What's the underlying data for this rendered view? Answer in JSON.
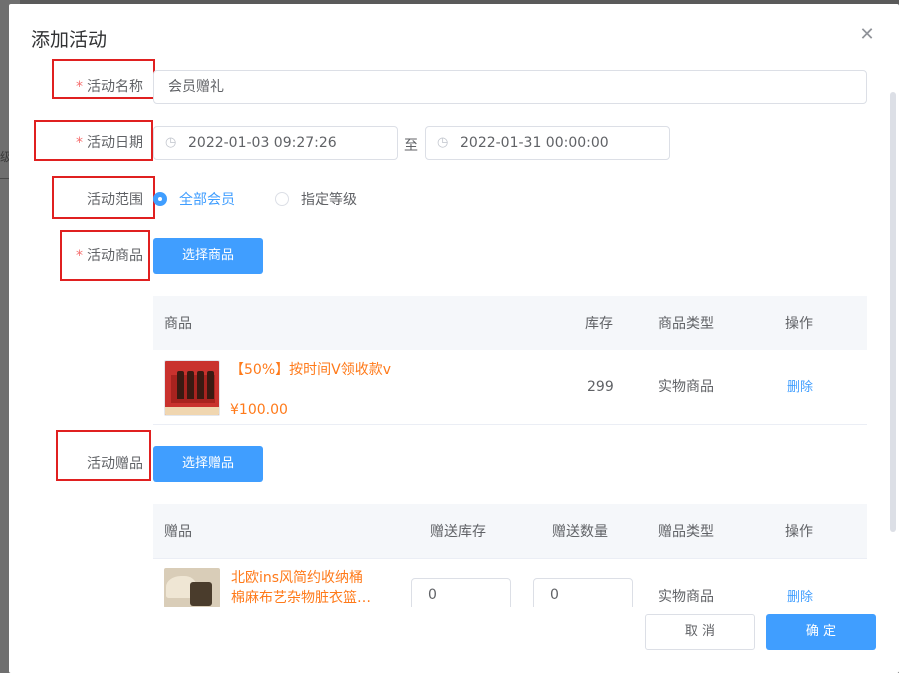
{
  "backdrop": {
    "fragment_text": "级"
  },
  "dialog": {
    "title": "添加活动",
    "close_icon": "close-icon"
  },
  "form": {
    "required_mark": "*",
    "name": {
      "label": "活动名称",
      "value": "会员赠礼"
    },
    "date": {
      "label": "活动日期",
      "start": "2022-01-03 09:27:26",
      "separator": "至",
      "end": "2022-01-31 00:00:00",
      "icon": "clock-icon"
    },
    "scope": {
      "label": "活动范围",
      "options": [
        {
          "label": "全部会员",
          "checked": true
        },
        {
          "label": "指定等级",
          "checked": false
        }
      ]
    },
    "products": {
      "label": "活动商品",
      "button": "选择商品",
      "columns": [
        "商品",
        "库存",
        "商品类型",
        "操作"
      ],
      "rows": [
        {
          "name": "【50%】按时间V领收款v",
          "price": "¥100.00",
          "stock": "299",
          "type": "实物商品",
          "action": "删除"
        }
      ]
    },
    "gifts": {
      "label": "活动赠品",
      "button": "选择赠品",
      "columns": [
        "赠品",
        "赠送库存",
        "赠送数量",
        "赠品类型",
        "操作"
      ],
      "rows": [
        {
          "name_line1": "北欧ins风简约收纳桶",
          "name_line2": "棉麻布艺杂物脏衣篮…",
          "stock_value": "0",
          "qty_value": "0",
          "type": "实物商品",
          "action": "删除"
        }
      ]
    }
  },
  "footer": {
    "cancel": "取 消",
    "confirm": "确 定"
  },
  "colors": {
    "primary": "#409eff",
    "accent_orange": "#ff7a1a",
    "required": "#f56c6c",
    "annotation_red": "#e02020"
  }
}
